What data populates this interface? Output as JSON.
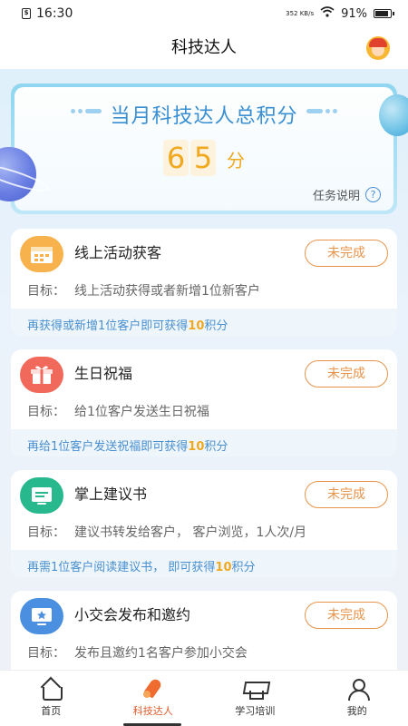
{
  "status_bar": {
    "time": "16:30",
    "speed": "352 KB/s",
    "battery": "91%"
  },
  "header": {
    "title": "科技达人"
  },
  "hero": {
    "title": "当月科技达人总积分",
    "score_digits": [
      "6",
      "5"
    ],
    "unit": "分",
    "help_label": "任务说明",
    "help_icon": "?"
  },
  "cards": [
    {
      "title": "线上活动获客",
      "status": "未完成",
      "goal_label": "目标：",
      "goal": "线上活动获得或者新增1位新客户",
      "footer_pre": "再获得或新增1位客户即可获得",
      "points": "10",
      "footer_post": "积分",
      "icon": "calendar-icon",
      "color": "#f7b24e"
    },
    {
      "title": "生日祝福",
      "status": "未完成",
      "goal_label": "目标：",
      "goal": "给1位客户发送生日祝福",
      "footer_pre": "再给1位客户发送祝福即可获得",
      "points": "10",
      "footer_post": "积分",
      "icon": "gift-icon",
      "color": "#f0695b"
    },
    {
      "title": "掌上建议书",
      "status": "未完成",
      "goal_label": "目标：",
      "goal": "建议书转发给客户， 客户浏览，1人次/月",
      "footer_pre": "再需1位客户阅读建议书， 即可获得",
      "points": "10",
      "footer_post": "积分",
      "icon": "proposal-icon",
      "color": "#27b88d"
    },
    {
      "title": "小交会发布和邀约",
      "status": "未完成",
      "goal_label": "目标：",
      "goal": "发布且邀约1名客户参加小交会",
      "icon": "presentation-icon",
      "color": "#4b8fe0"
    }
  ],
  "tabs": [
    {
      "label": "首页",
      "icon": "home-icon"
    },
    {
      "label": "科技达人",
      "icon": "rocket-icon",
      "active": true
    },
    {
      "label": "学习培训",
      "icon": "graduation-cap-icon"
    },
    {
      "label": "我的",
      "icon": "user-icon"
    }
  ]
}
